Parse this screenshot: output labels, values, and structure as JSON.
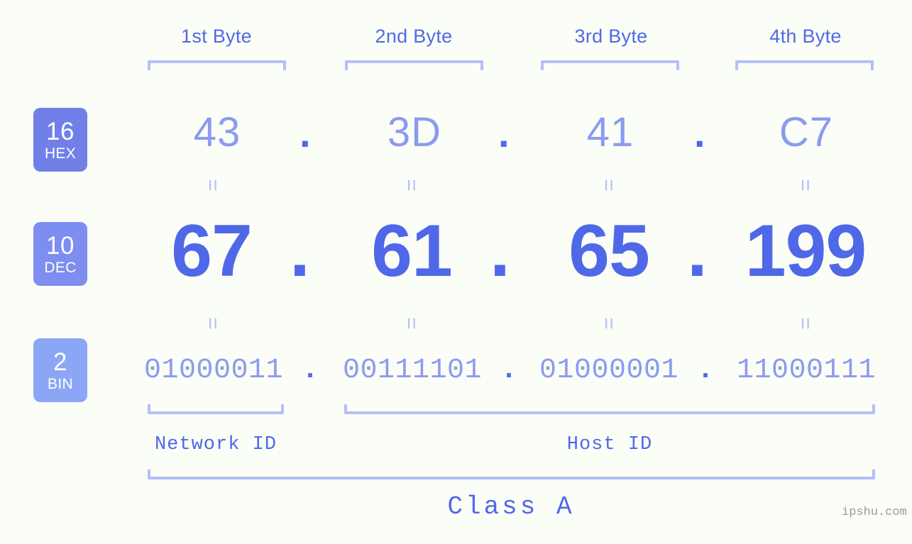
{
  "meta": {
    "background_color": "#fbfdf7",
    "accent_strong": "#4f68e8",
    "accent_light": "#8b9bf0",
    "bracket_color": "#b3bffa"
  },
  "headers": [
    {
      "label": "1st Byte"
    },
    {
      "label": "2nd Byte"
    },
    {
      "label": "3rd Byte"
    },
    {
      "label": "4th Byte"
    }
  ],
  "badges": [
    {
      "num": "16",
      "abbr": "HEX",
      "color": "#7180e8"
    },
    {
      "num": "10",
      "abbr": "DEC",
      "color": "#7d8df0"
    },
    {
      "num": "2",
      "abbr": "BIN",
      "color": "#8aa6f5"
    }
  ],
  "rows": {
    "hex": {
      "values": [
        "43",
        "3D",
        "41",
        "C7"
      ]
    },
    "dec": {
      "values": [
        "67",
        "61",
        "65",
        "199"
      ]
    },
    "bin": {
      "values": [
        "01000011",
        "00111101",
        "01000001",
        "11000111"
      ]
    }
  },
  "separators": {
    "dot": "."
  },
  "connectors": {
    "equals": "="
  },
  "sections": [
    {
      "label": "Network ID"
    },
    {
      "label": "Host ID"
    }
  ],
  "class": {
    "label": "Class A"
  },
  "watermark": {
    "text": "ipshu.com"
  }
}
